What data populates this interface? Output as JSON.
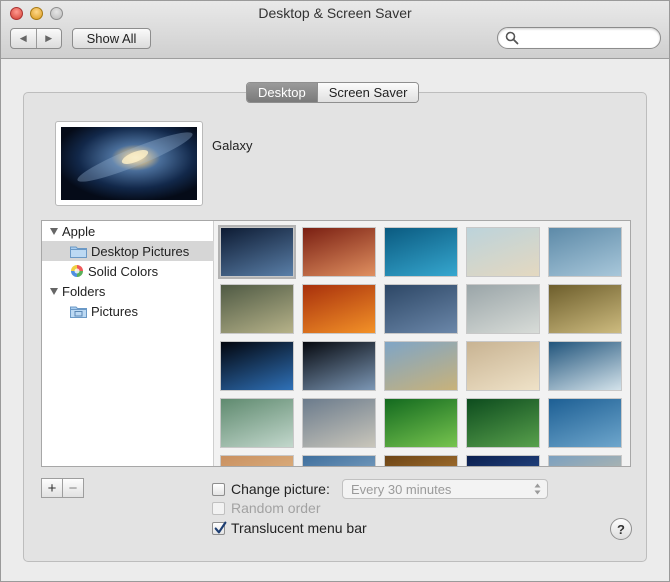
{
  "window": {
    "title": "Desktop & Screen Saver"
  },
  "toolbar": {
    "back_glyph": "◀",
    "forward_glyph": "▶",
    "show_all_label": "Show All",
    "search_placeholder": "",
    "search_value": ""
  },
  "tabs": [
    {
      "label": "Desktop",
      "active": true
    },
    {
      "label": "Screen Saver",
      "active": false
    }
  ],
  "current_picture": {
    "name": "Galaxy"
  },
  "sources": {
    "groups": [
      {
        "label": "Apple",
        "items": [
          {
            "label": "Desktop Pictures",
            "icon": "folder-icon",
            "selected": true
          },
          {
            "label": "Solid Colors",
            "icon": "color-wheel-icon",
            "selected": false
          }
        ]
      },
      {
        "label": "Folders",
        "items": [
          {
            "label": "Pictures",
            "icon": "pictures-folder-icon",
            "selected": false
          }
        ]
      }
    ]
  },
  "thumbnails": [
    {
      "name": "galaxy",
      "c1": "#0d1b33",
      "c2": "#5a7fa8",
      "selected": true
    },
    {
      "name": "antelope-canyon",
      "c1": "#7a1f12",
      "c2": "#e09060"
    },
    {
      "name": "ocean-waves",
      "c1": "#0a5a80",
      "c2": "#36a7cf"
    },
    {
      "name": "beach-shore",
      "c1": "#bcd3db",
      "c2": "#e4d8c0"
    },
    {
      "name": "blue-forest",
      "c1": "#5d8aa8",
      "c2": "#a8c7da"
    },
    {
      "name": "grass-field",
      "c1": "#4f5a44",
      "c2": "#b6b289"
    },
    {
      "name": "autumn-leaves",
      "c1": "#a8300c",
      "c2": "#f39228"
    },
    {
      "name": "water-ripples",
      "c1": "#2d4766",
      "c2": "#6b87a9"
    },
    {
      "name": "misty-lake",
      "c1": "#9aa5a8",
      "c2": "#d8dcd8"
    },
    {
      "name": "eagle-sky",
      "c1": "#6d5e2c",
      "c2": "#cdbb7f"
    },
    {
      "name": "earth-horizon",
      "c1": "#02050d",
      "c2": "#2f71b8"
    },
    {
      "name": "earth-space",
      "c1": "#06090f",
      "c2": "#7c97b5"
    },
    {
      "name": "elephant-savanna",
      "c1": "#7fa5c6",
      "c2": "#c8b27a"
    },
    {
      "name": "birds-plain",
      "c1": "#c8b392",
      "c2": "#efe2c8"
    },
    {
      "name": "ice-floes",
      "c1": "#22557c",
      "c2": "#d3e2ea"
    },
    {
      "name": "lily-pads",
      "c1": "#5f8a6f",
      "c2": "#c2d7cc"
    },
    {
      "name": "valley-clouds",
      "c1": "#6b7b8c",
      "c2": "#c9c6bb"
    },
    {
      "name": "frog-leaf",
      "c1": "#136a1f",
      "c2": "#77c44f"
    },
    {
      "name": "green-grass",
      "c1": "#0d4c1e",
      "c2": "#58a04c"
    },
    {
      "name": "blue-water",
      "c1": "#1d5f94",
      "c2": "#6ea6cc"
    },
    {
      "name": "desert-dawn",
      "c1": "#c99060",
      "c2": "#e8c493"
    },
    {
      "name": "lake-blue",
      "c1": "#3f6f9d",
      "c2": "#9bbad4"
    },
    {
      "name": "lion",
      "c1": "#6c4416",
      "c2": "#c88d3f"
    },
    {
      "name": "night-blue",
      "c1": "#0a1e4e",
      "c2": "#3660a6"
    },
    {
      "name": "sand-blue",
      "c1": "#7ba0c0",
      "c2": "#d3c4a4"
    }
  ],
  "options": {
    "add_label": "+",
    "remove_label": "−",
    "change_picture": {
      "label": "Change picture:",
      "checked": false
    },
    "interval": {
      "selected": "Every 30 minutes"
    },
    "random_order": {
      "label": "Random order",
      "checked": false,
      "enabled": false
    },
    "translucent_menu_bar": {
      "label": "Translucent menu bar",
      "checked": true
    }
  },
  "help_label": "?"
}
